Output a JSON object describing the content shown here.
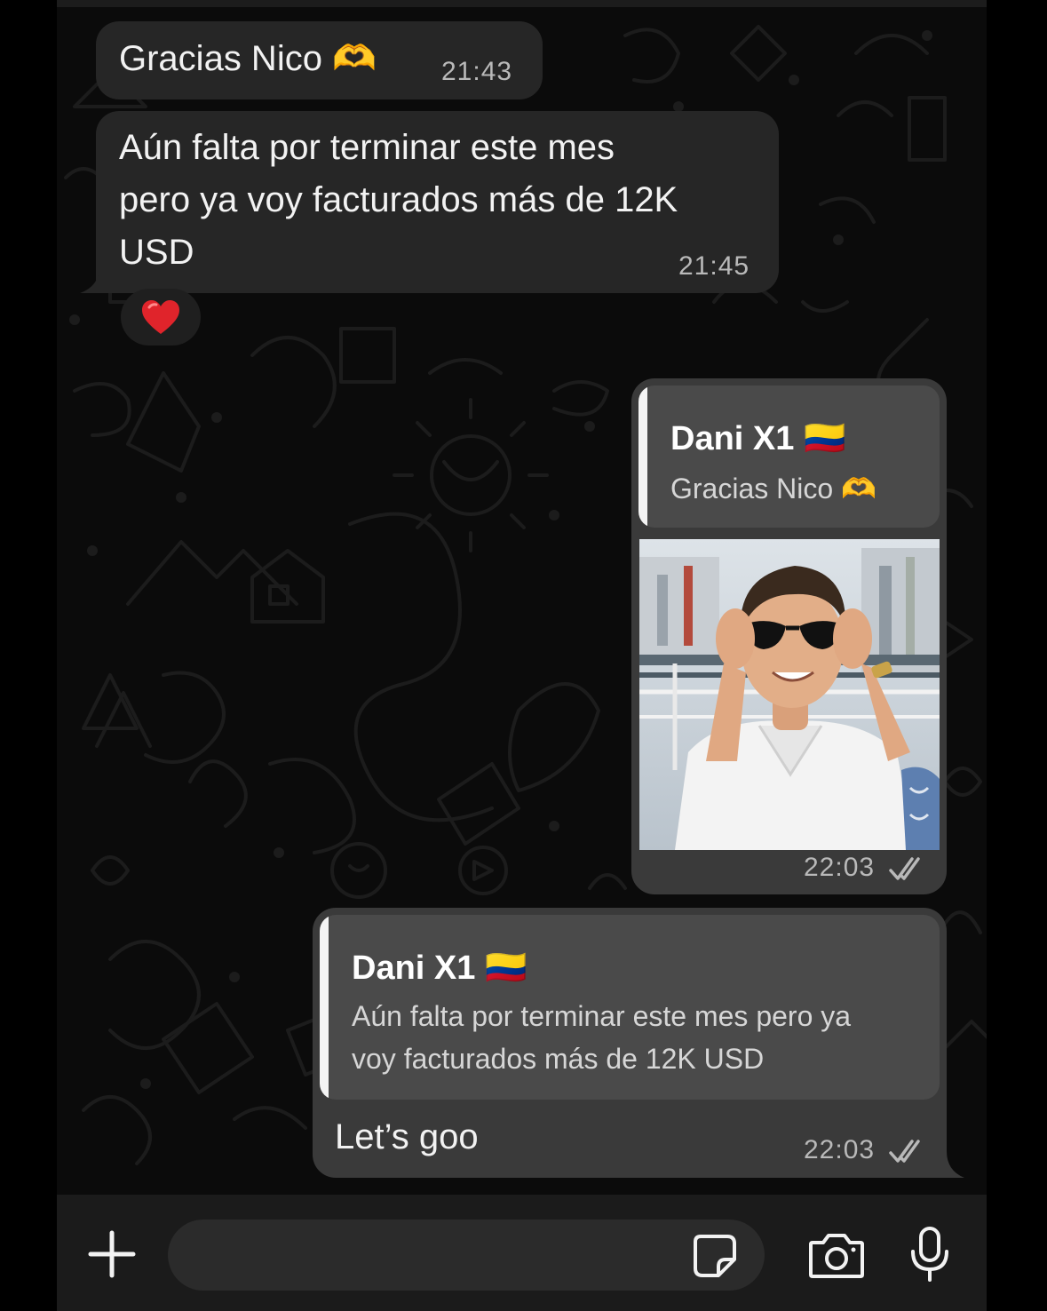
{
  "messages": [
    {
      "direction": "incoming",
      "text": "Gracias Nico 🫶",
      "time": "21:43"
    },
    {
      "direction": "incoming",
      "text": "Aún falta por terminar este mes pero ya voy facturados más de 12K USD",
      "lines": [
        "Aún falta por terminar este mes",
        "pero ya voy facturados más de 12K",
        "USD"
      ],
      "time": "21:45",
      "reaction": "❤️"
    },
    {
      "direction": "outgoing",
      "reply_to": {
        "author": "Dani X1 🇨🇴",
        "text": "Gracias Nico 🫶"
      },
      "media": "photo",
      "time": "22:03",
      "status": "read"
    },
    {
      "direction": "outgoing",
      "reply_to": {
        "author": "Dani X1 🇨🇴",
        "lines": [
          "Aún falta por terminar este mes pero ya",
          "voy facturados más de 12K USD"
        ]
      },
      "text": "Let’s goo",
      "time": "22:03",
      "status": "read"
    }
  ],
  "composer": {
    "left_icon": "plus-icon",
    "field_icon": "sticker-icon",
    "right_icons": [
      "camera-icon",
      "microphone-icon"
    ]
  },
  "colors": {
    "background": "#0b0b0b",
    "incoming_bubble": "#262626",
    "outgoing_bubble": "#3a3a3a",
    "quote_background": "#4a4a4a",
    "text": "#f2f2f2",
    "read_ticks": "#b9b9b9"
  }
}
